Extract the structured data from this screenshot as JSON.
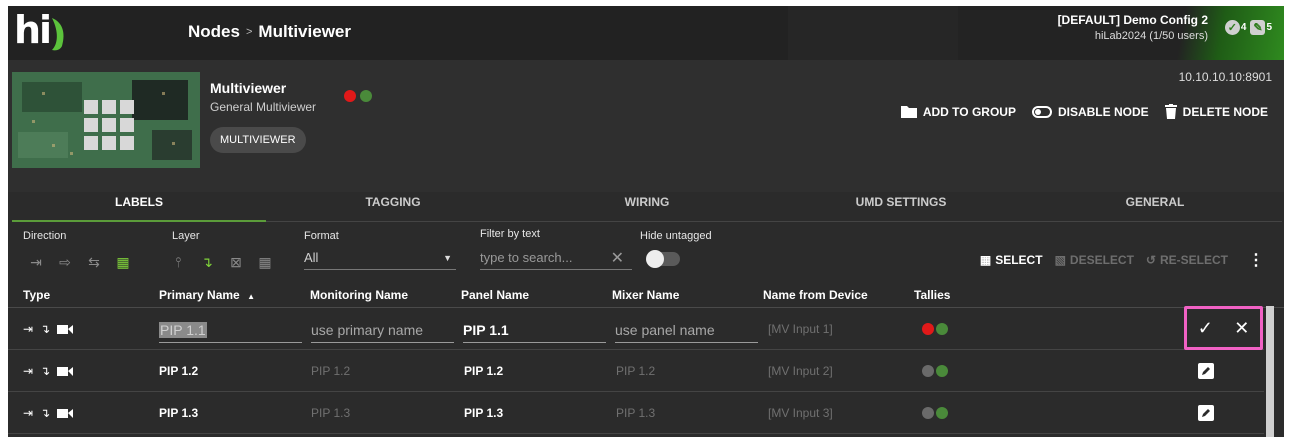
{
  "header": {
    "logo_text": "hi",
    "breadcrumb": {
      "root": "Nodes",
      "separator": ">",
      "current": "Multiviewer"
    },
    "config_name": "[DEFAULT] Demo Config 2",
    "config_user": "hiLab2024 (1/50 users)",
    "badge_check_count": "4",
    "badge_chat_count": "5",
    "colors": {
      "accent": "#2f8a1f",
      "bar": "#222222"
    }
  },
  "node": {
    "title": "Multiviewer",
    "subtitle": "General Multiviewer",
    "chip": "MULTIVIEWER",
    "ip": "10.10.10.10:8901",
    "actions": {
      "add_to_group": "ADD TO GROUP",
      "disable_node": "DISABLE NODE",
      "delete_node": "DELETE NODE"
    }
  },
  "tabs": [
    "LABELS",
    "TAGGING",
    "WIRING",
    "UMD SETTINGS",
    "GENERAL"
  ],
  "filters": {
    "direction_label": "Direction",
    "layer_label": "Layer",
    "format_label": "Format",
    "format_value": "All",
    "filter_label": "Filter by text",
    "filter_placeholder": "type to search...",
    "hide_untagged_label": "Hide untagged",
    "select": "SELECT",
    "deselect": "DESELECT",
    "reselect": "RE-SELECT"
  },
  "table": {
    "columns": [
      "Type",
      "Primary Name",
      "Monitoring Name",
      "Panel Name",
      "Mixer Name",
      "Name from Device",
      "Tallies"
    ],
    "sort_indicator": "▲",
    "edit_row": {
      "primary": "PIP 1.1",
      "monitoring_placeholder": "use primary name",
      "panel": "PIP 1.1",
      "mixer_placeholder": "use panel name",
      "device": "[MV Input 1]"
    },
    "rows": [
      {
        "primary": "PIP 1.2",
        "monitoring": "PIP 1.2",
        "panel": "PIP 1.2",
        "mixer": "PIP 1.2",
        "device": "[MV Input 2]"
      },
      {
        "primary": "PIP 1.3",
        "monitoring": "PIP 1.3",
        "panel": "PIP 1.3",
        "mixer": "PIP 1.3",
        "device": "[MV Input 3]"
      }
    ]
  }
}
